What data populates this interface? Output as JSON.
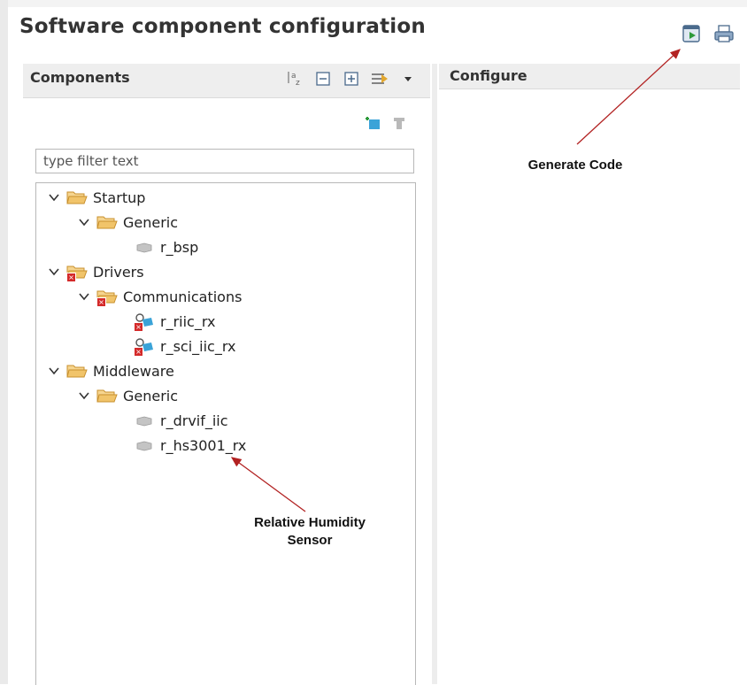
{
  "title": "Software component configuration",
  "toolbar": {
    "generate_icon": "generate-code-icon",
    "print_icon": "print-icon"
  },
  "components_panel": {
    "title": "Components",
    "filter_placeholder": "type filter text",
    "tree": {
      "startup": "Startup",
      "startup_generic": "Generic",
      "r_bsp": "r_bsp",
      "drivers": "Drivers",
      "communications": "Communications",
      "r_riic_rx": "r_riic_rx",
      "r_sci_iic_rx": "r_sci_iic_rx",
      "middleware": "Middleware",
      "middleware_generic": "Generic",
      "r_drvif_iic": "r_drvif_iic",
      "r_hs3001_rx": "r_hs3001_rx"
    }
  },
  "configure_panel": {
    "title": "Configure"
  },
  "annotations": {
    "generate_code": "Generate Code",
    "sensor_line1": "Relative Humidity",
    "sensor_line2": "Sensor"
  },
  "colors": {
    "folder": "#e6b25a",
    "error": "#d42a2a",
    "arrow": "#b22222"
  }
}
